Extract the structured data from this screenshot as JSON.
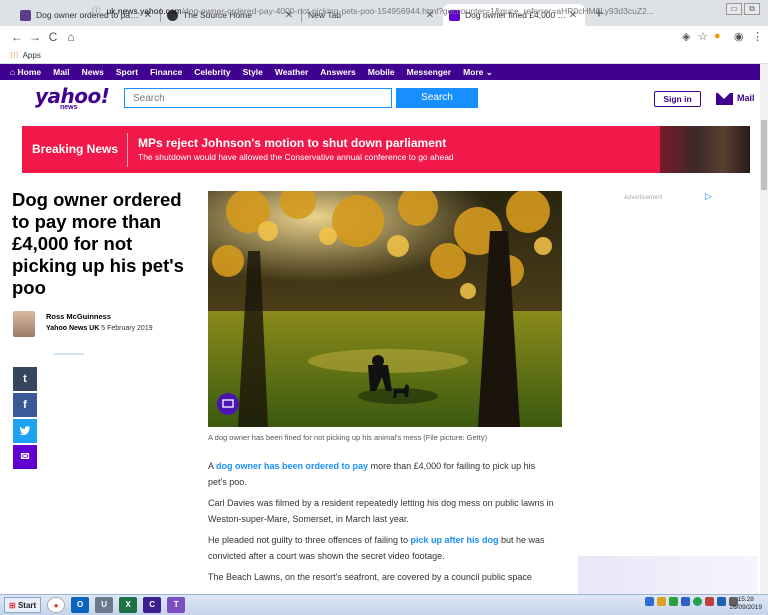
{
  "browser": {
    "tabs": [
      {
        "title": "Dog owner ordered to pay over ...",
        "favicon_color": "#5a3e8a"
      },
      {
        "title": "The Source Home",
        "favicon_color": "#333333"
      },
      {
        "title": "New Tab",
        "favicon_color": ""
      },
      {
        "title": "Dog owner fined £4,000 for not ...",
        "favicon_color": "#6001d2"
      }
    ],
    "new_tab": "+",
    "window_controls": [
      "▭",
      "⧉",
      "✕"
    ],
    "url_host": "uk.news.yahoo.com",
    "url_path": "/dog-owner-ordered-pay-4000-not-picking-pets-poo-154956944.html?guccounter=1&guce_referrer=aHR0cHM6Ly93d3cuZ2...",
    "bookmarks_apps": "Apps"
  },
  "yahoo_nav": [
    "Home",
    "Mail",
    "News",
    "Sport",
    "Finance",
    "Celebrity",
    "Style",
    "Weather",
    "Answers",
    "Mobile",
    "Messenger",
    "More ⌄"
  ],
  "header": {
    "logo": "yahoo!",
    "logo_sub": "news",
    "search_placeholder": "Search",
    "search_button": "Search",
    "signin": "Sign in",
    "mail": "Mail"
  },
  "breaking": {
    "label": "Breaking News",
    "headline": "MPs reject Johnson's motion to shut down parliament",
    "sub": "The shutdown would have allowed the Conservative annual conference to go ahead"
  },
  "article": {
    "headline": "Dog owner ordered to pay more than £4,000 for not picking up his pet's poo",
    "author": "Ross McGuinness",
    "source": "Yahoo News UK",
    "date": "5 February 2019",
    "caption": "A dog owner has been fined for not picking up his animal's mess (File picture: Getty)",
    "p1_a": "A",
    "p1_link": "dog owner has been ordered to pay",
    "p1_b": "more than £4,000 for failing to pick up his pet's poo.",
    "p2": "Carl Davies was filmed by a resident repeatedly letting his dog mess on public lawns in Weston-super-Mare, Somerset, in March last year.",
    "p3_a": "He pleaded not guilty to three offences of failing to",
    "p3_link": "pick up after his dog",
    "p3_b": "but he was convicted after a court was shown the secret video footage.",
    "p4": "The Beach Lawns, on the resort's seafront, are covered by a council public space"
  },
  "share": [
    {
      "icon": "t",
      "color": "#35465c"
    },
    {
      "icon": "f",
      "color": "#3b5998"
    },
    {
      "icon": "🐦",
      "color": "#1da1f2"
    },
    {
      "icon": "✉",
      "color": "#6001d2"
    }
  ],
  "ad": {
    "label": "Advertisement",
    "icon": "▷"
  },
  "taskbar": {
    "start": "Start",
    "time": "15:28",
    "date": "26/09/2019"
  }
}
